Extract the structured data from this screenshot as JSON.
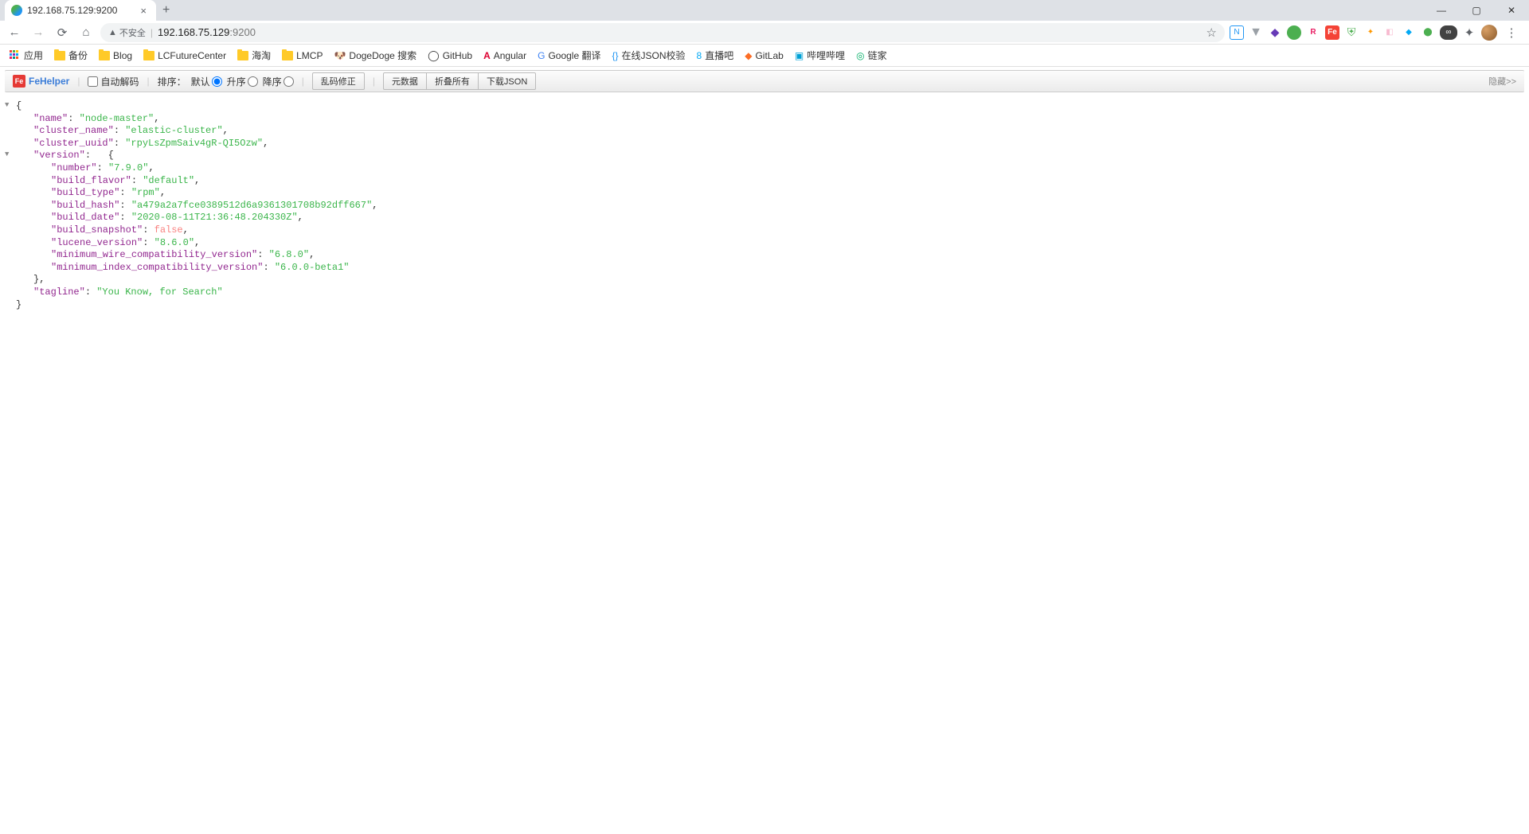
{
  "window": {
    "tab_title": "192.168.75.129:9200",
    "min": "—",
    "max": "▢",
    "close": "✕"
  },
  "address": {
    "security_text": "不安全",
    "host": "192.168.75.129",
    "port": ":9200",
    "star": "☆"
  },
  "bookmarks": {
    "apps": "应用",
    "items": [
      "备份",
      "Blog",
      "LCFutureCenter",
      "海淘",
      "LMCP",
      "DogeDoge 搜索",
      "GitHub",
      "Angular",
      "Google 翻译",
      "在线JSON校验",
      "直播吧",
      "GitLab",
      "哔哩哔哩",
      "链家"
    ]
  },
  "fehelper": {
    "brand": "FeHelper",
    "auto_decode": "自动解码",
    "sort_label": "排序：",
    "sort_default": "默认",
    "sort_asc": "升序",
    "sort_desc": "降序",
    "btn_fix": "乱码修正",
    "btn_raw": "元数据",
    "btn_collapse": "折叠所有",
    "btn_download": "下载JSON",
    "hide": "隐藏>>"
  },
  "json": {
    "name_k": "\"name\"",
    "name_v": "\"node-master\"",
    "cluster_name_k": "\"cluster_name\"",
    "cluster_name_v": "\"elastic-cluster\"",
    "cluster_uuid_k": "\"cluster_uuid\"",
    "cluster_uuid_v": "\"rpyLsZpmSaiv4gR-QI5Ozw\"",
    "version_k": "\"version\"",
    "number_k": "\"number\"",
    "number_v": "\"7.9.0\"",
    "build_flavor_k": "\"build_flavor\"",
    "build_flavor_v": "\"default\"",
    "build_type_k": "\"build_type\"",
    "build_type_v": "\"rpm\"",
    "build_hash_k": "\"build_hash\"",
    "build_hash_v": "\"a479a2a7fce0389512d6a9361301708b92dff667\"",
    "build_date_k": "\"build_date\"",
    "build_date_v": "\"2020-08-11T21:36:48.204330Z\"",
    "build_snapshot_k": "\"build_snapshot\"",
    "build_snapshot_v": "false",
    "lucene_version_k": "\"lucene_version\"",
    "lucene_version_v": "\"8.6.0\"",
    "min_wire_k": "\"minimum_wire_compatibility_version\"",
    "min_wire_v": "\"6.8.0\"",
    "min_index_k": "\"minimum_index_compatibility_version\"",
    "min_index_v": "\"6.0.0-beta1\"",
    "tagline_k": "\"tagline\"",
    "tagline_v": "\"You Know, for Search\""
  }
}
